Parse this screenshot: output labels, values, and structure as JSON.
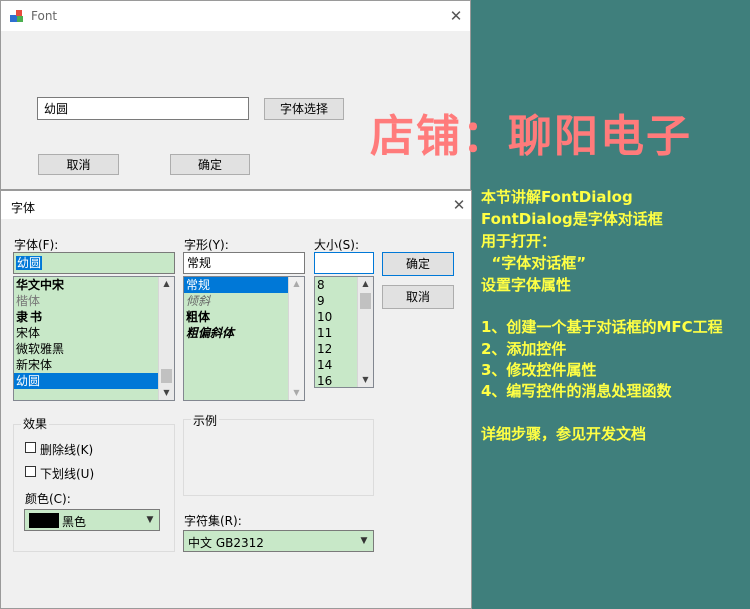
{
  "app_window": {
    "title": "Font",
    "input_value": "幼圆",
    "choose_font_button": "字体选择",
    "cancel_button": "取消",
    "ok_button": "确定"
  },
  "watermark": "店铺：聊阳电子",
  "font_dialog": {
    "title": "字体",
    "font_label": "字体(F):",
    "font_value": "幼圆",
    "font_list": [
      "华文中宋",
      "楷体",
      "隶书",
      "宋体",
      "微软雅黑",
      "新宋体",
      "幼圆"
    ],
    "style_label": "字形(Y):",
    "style_value": "常规",
    "style_list": [
      "常规",
      "倾斜",
      "粗体",
      "粗偏斜体"
    ],
    "size_label": "大小(S):",
    "size_value": "",
    "size_list": [
      "8",
      "9",
      "10",
      "11",
      "12",
      "14",
      "16"
    ],
    "ok_button": "确定",
    "cancel_button": "取消",
    "effects_label": "效果",
    "strikeout_label": "删除线(K)",
    "underline_label": "下划线(U)",
    "color_label": "颜色(C):",
    "color_value": "黑色",
    "color_swatch": "#000000",
    "sample_label": "示例",
    "charset_label": "字符集(R):",
    "charset_value": "中文 GB2312",
    "close_glyph": "✕"
  },
  "info_lines": [
    "本节讲解FontDialog",
    "FontDialog是字体对话框",
    "用于打开：",
    "  “字体对话框”",
    "设置字体属性",
    "",
    "1、创建一个基于对话框的MFC工程",
    "2、添加控件",
    "3、修改控件属性",
    "4、编写控件的消息处理函数",
    "",
    "详细步骤，参见开发文档"
  ],
  "colors": {
    "background": "#3f7f7c",
    "info_text": "#ffff44",
    "watermark": "#ff7b7b",
    "list_bg": "#c8e8c8",
    "selection": "#0078d7"
  }
}
